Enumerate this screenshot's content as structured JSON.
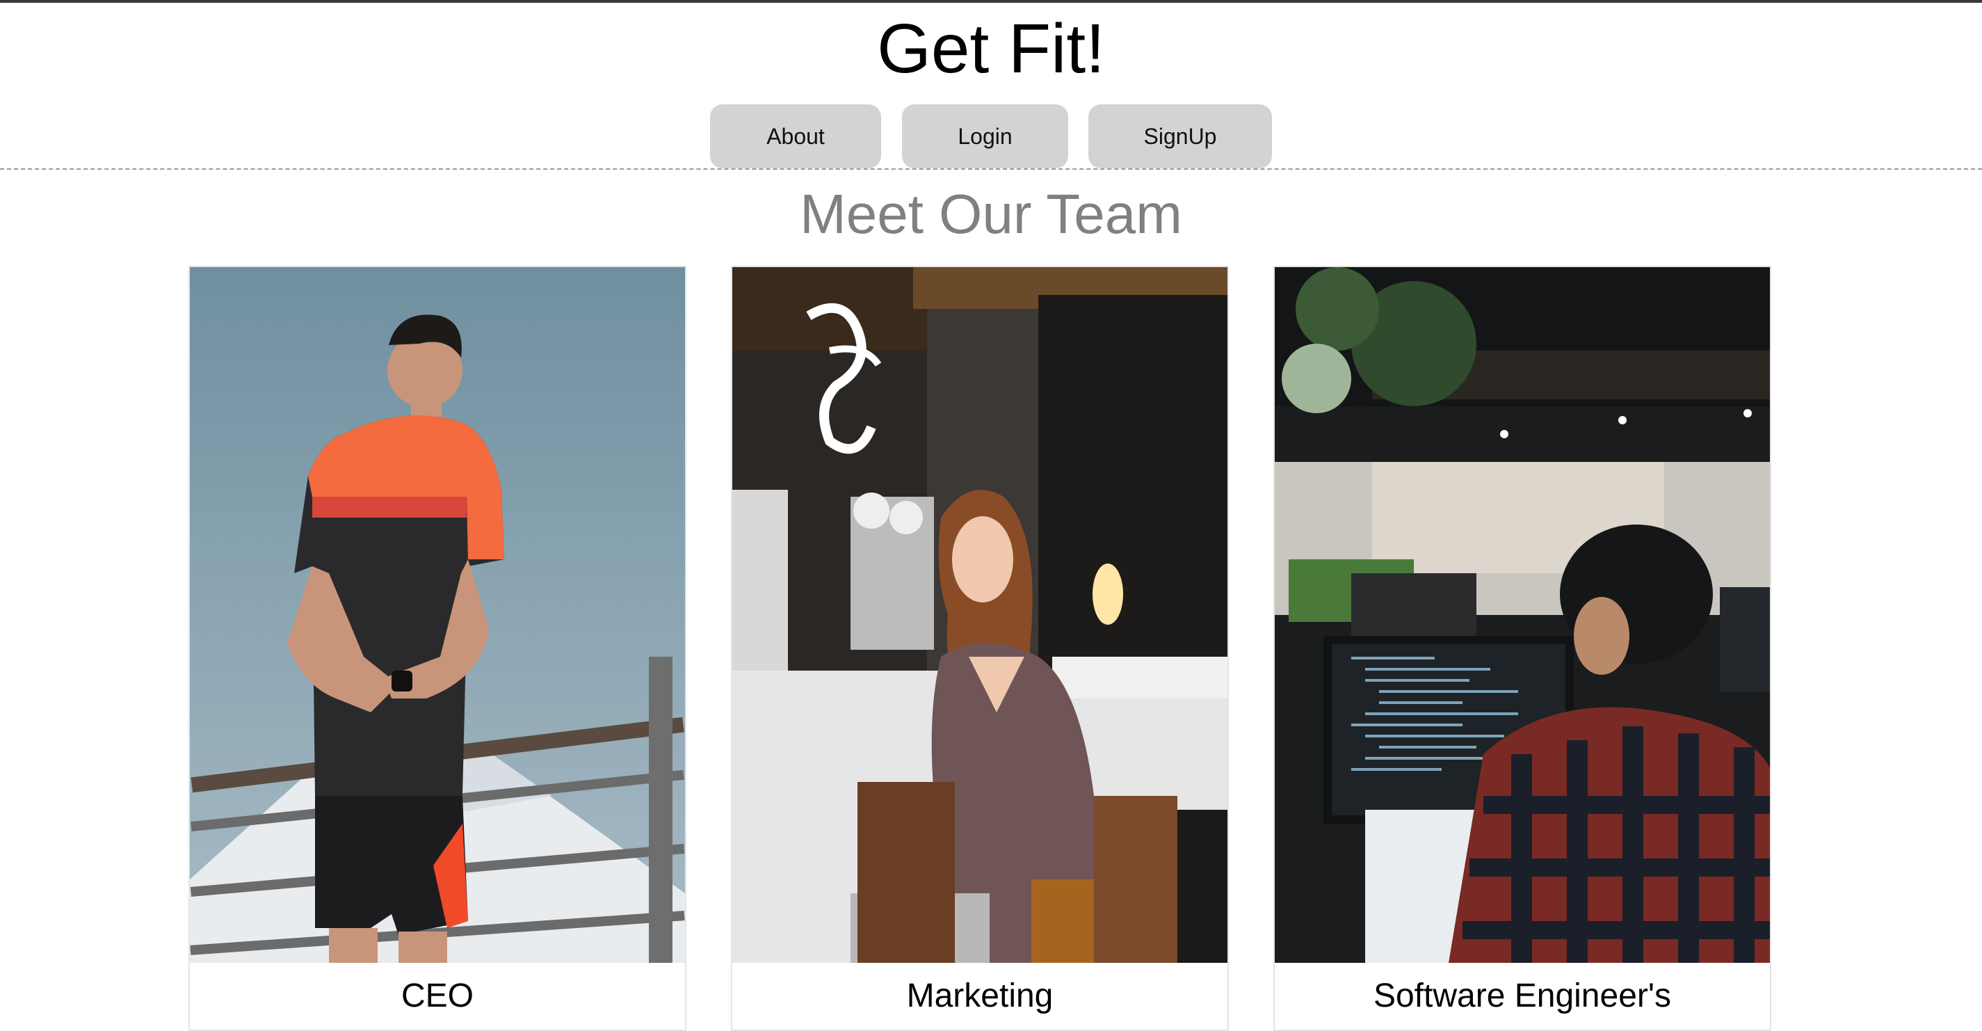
{
  "header": {
    "title": "Get Fit!",
    "nav": {
      "about_label": "About",
      "login_label": "Login",
      "signup_label": "SignUp"
    }
  },
  "team": {
    "heading": "Meet Our Team",
    "members": [
      {
        "role": "CEO",
        "photo_icon": "athlete-photo"
      },
      {
        "role": "Marketing",
        "photo_icon": "cafe-laptop-photo"
      },
      {
        "role": "Software Engineer's",
        "photo_icon": "office-coder-photo"
      }
    ]
  },
  "colors": {
    "nav_button_bg": "#d3d3d3",
    "heading_gray": "#808080",
    "card_border": "#e4e4e4"
  }
}
